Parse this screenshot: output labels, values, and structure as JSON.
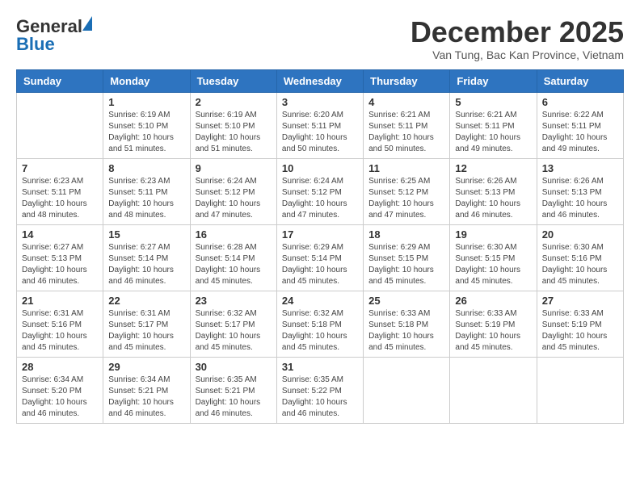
{
  "header": {
    "logo_line1": "General",
    "logo_line2": "Blue",
    "month_title": "December 2025",
    "location": "Van Tung, Bac Kan Province, Vietnam"
  },
  "weekdays": [
    "Sunday",
    "Monday",
    "Tuesday",
    "Wednesday",
    "Thursday",
    "Friday",
    "Saturday"
  ],
  "weeks": [
    [
      {
        "day": "",
        "sunrise": "",
        "sunset": "",
        "daylight": ""
      },
      {
        "day": "1",
        "sunrise": "Sunrise: 6:19 AM",
        "sunset": "Sunset: 5:10 PM",
        "daylight": "Daylight: 10 hours and 51 minutes."
      },
      {
        "day": "2",
        "sunrise": "Sunrise: 6:19 AM",
        "sunset": "Sunset: 5:10 PM",
        "daylight": "Daylight: 10 hours and 51 minutes."
      },
      {
        "day": "3",
        "sunrise": "Sunrise: 6:20 AM",
        "sunset": "Sunset: 5:11 PM",
        "daylight": "Daylight: 10 hours and 50 minutes."
      },
      {
        "day": "4",
        "sunrise": "Sunrise: 6:21 AM",
        "sunset": "Sunset: 5:11 PM",
        "daylight": "Daylight: 10 hours and 50 minutes."
      },
      {
        "day": "5",
        "sunrise": "Sunrise: 6:21 AM",
        "sunset": "Sunset: 5:11 PM",
        "daylight": "Daylight: 10 hours and 49 minutes."
      },
      {
        "day": "6",
        "sunrise": "Sunrise: 6:22 AM",
        "sunset": "Sunset: 5:11 PM",
        "daylight": "Daylight: 10 hours and 49 minutes."
      }
    ],
    [
      {
        "day": "7",
        "sunrise": "Sunrise: 6:23 AM",
        "sunset": "Sunset: 5:11 PM",
        "daylight": "Daylight: 10 hours and 48 minutes."
      },
      {
        "day": "8",
        "sunrise": "Sunrise: 6:23 AM",
        "sunset": "Sunset: 5:11 PM",
        "daylight": "Daylight: 10 hours and 48 minutes."
      },
      {
        "day": "9",
        "sunrise": "Sunrise: 6:24 AM",
        "sunset": "Sunset: 5:12 PM",
        "daylight": "Daylight: 10 hours and 47 minutes."
      },
      {
        "day": "10",
        "sunrise": "Sunrise: 6:24 AM",
        "sunset": "Sunset: 5:12 PM",
        "daylight": "Daylight: 10 hours and 47 minutes."
      },
      {
        "day": "11",
        "sunrise": "Sunrise: 6:25 AM",
        "sunset": "Sunset: 5:12 PM",
        "daylight": "Daylight: 10 hours and 47 minutes."
      },
      {
        "day": "12",
        "sunrise": "Sunrise: 6:26 AM",
        "sunset": "Sunset: 5:13 PM",
        "daylight": "Daylight: 10 hours and 46 minutes."
      },
      {
        "day": "13",
        "sunrise": "Sunrise: 6:26 AM",
        "sunset": "Sunset: 5:13 PM",
        "daylight": "Daylight: 10 hours and 46 minutes."
      }
    ],
    [
      {
        "day": "14",
        "sunrise": "Sunrise: 6:27 AM",
        "sunset": "Sunset: 5:13 PM",
        "daylight": "Daylight: 10 hours and 46 minutes."
      },
      {
        "day": "15",
        "sunrise": "Sunrise: 6:27 AM",
        "sunset": "Sunset: 5:14 PM",
        "daylight": "Daylight: 10 hours and 46 minutes."
      },
      {
        "day": "16",
        "sunrise": "Sunrise: 6:28 AM",
        "sunset": "Sunset: 5:14 PM",
        "daylight": "Daylight: 10 hours and 45 minutes."
      },
      {
        "day": "17",
        "sunrise": "Sunrise: 6:29 AM",
        "sunset": "Sunset: 5:14 PM",
        "daylight": "Daylight: 10 hours and 45 minutes."
      },
      {
        "day": "18",
        "sunrise": "Sunrise: 6:29 AM",
        "sunset": "Sunset: 5:15 PM",
        "daylight": "Daylight: 10 hours and 45 minutes."
      },
      {
        "day": "19",
        "sunrise": "Sunrise: 6:30 AM",
        "sunset": "Sunset: 5:15 PM",
        "daylight": "Daylight: 10 hours and 45 minutes."
      },
      {
        "day": "20",
        "sunrise": "Sunrise: 6:30 AM",
        "sunset": "Sunset: 5:16 PM",
        "daylight": "Daylight: 10 hours and 45 minutes."
      }
    ],
    [
      {
        "day": "21",
        "sunrise": "Sunrise: 6:31 AM",
        "sunset": "Sunset: 5:16 PM",
        "daylight": "Daylight: 10 hours and 45 minutes."
      },
      {
        "day": "22",
        "sunrise": "Sunrise: 6:31 AM",
        "sunset": "Sunset: 5:17 PM",
        "daylight": "Daylight: 10 hours and 45 minutes."
      },
      {
        "day": "23",
        "sunrise": "Sunrise: 6:32 AM",
        "sunset": "Sunset: 5:17 PM",
        "daylight": "Daylight: 10 hours and 45 minutes."
      },
      {
        "day": "24",
        "sunrise": "Sunrise: 6:32 AM",
        "sunset": "Sunset: 5:18 PM",
        "daylight": "Daylight: 10 hours and 45 minutes."
      },
      {
        "day": "25",
        "sunrise": "Sunrise: 6:33 AM",
        "sunset": "Sunset: 5:18 PM",
        "daylight": "Daylight: 10 hours and 45 minutes."
      },
      {
        "day": "26",
        "sunrise": "Sunrise: 6:33 AM",
        "sunset": "Sunset: 5:19 PM",
        "daylight": "Daylight: 10 hours and 45 minutes."
      },
      {
        "day": "27",
        "sunrise": "Sunrise: 6:33 AM",
        "sunset": "Sunset: 5:19 PM",
        "daylight": "Daylight: 10 hours and 45 minutes."
      }
    ],
    [
      {
        "day": "28",
        "sunrise": "Sunrise: 6:34 AM",
        "sunset": "Sunset: 5:20 PM",
        "daylight": "Daylight: 10 hours and 46 minutes."
      },
      {
        "day": "29",
        "sunrise": "Sunrise: 6:34 AM",
        "sunset": "Sunset: 5:21 PM",
        "daylight": "Daylight: 10 hours and 46 minutes."
      },
      {
        "day": "30",
        "sunrise": "Sunrise: 6:35 AM",
        "sunset": "Sunset: 5:21 PM",
        "daylight": "Daylight: 10 hours and 46 minutes."
      },
      {
        "day": "31",
        "sunrise": "Sunrise: 6:35 AM",
        "sunset": "Sunset: 5:22 PM",
        "daylight": "Daylight: 10 hours and 46 minutes."
      },
      {
        "day": "",
        "sunrise": "",
        "sunset": "",
        "daylight": ""
      },
      {
        "day": "",
        "sunrise": "",
        "sunset": "",
        "daylight": ""
      },
      {
        "day": "",
        "sunrise": "",
        "sunset": "",
        "daylight": ""
      }
    ]
  ]
}
